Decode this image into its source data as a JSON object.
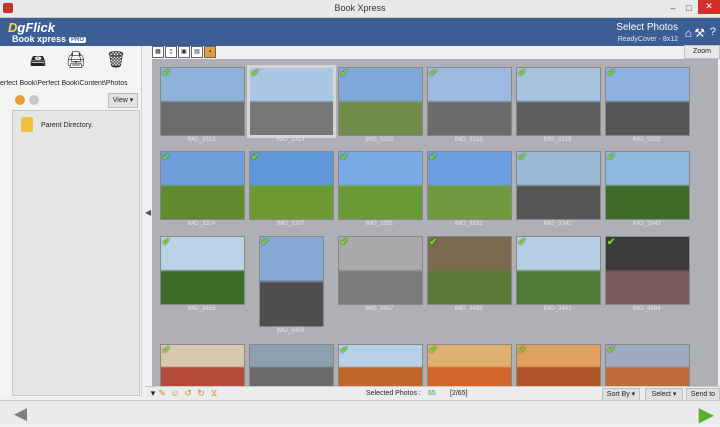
{
  "window": {
    "title": "Book Xpress",
    "min": "–",
    "max": "□",
    "close": "✕"
  },
  "header": {
    "logo_top_prefix": "D",
    "logo_top_rest": "gFlick",
    "logo_bottom": "Book xpress",
    "logo_badge": "PRO",
    "step_title": "Select Photos",
    "step_sub": "ReadyCover - 8x12",
    "icons": [
      "home-icon",
      "wrench-icon",
      "help-icon"
    ],
    "help_glyph": "?"
  },
  "sidebar": {
    "path": "erfect Book\\Perfect Book\\Content\\Photos",
    "view_label": "View ▾",
    "parent_dir_label": "Parent Directory."
  },
  "toolbar": {
    "zoom_label": "Zoom"
  },
  "thumbnails": [
    {
      "label": "IMG_3312",
      "checked": true
    },
    {
      "label": "IMG_3314",
      "checked": true,
      "selected": true
    },
    {
      "label": "IMG_3315",
      "checked": true
    },
    {
      "label": "IMG_3316",
      "checked": true
    },
    {
      "label": "IMG_3319",
      "checked": true
    },
    {
      "label": "IMG_3322",
      "checked": true
    },
    {
      "label": "IMG_3324",
      "checked": true
    },
    {
      "label": "IMG_3327",
      "checked": true
    },
    {
      "label": "IMG_3331",
      "checked": true
    },
    {
      "label": "IMG_3332",
      "checked": true
    },
    {
      "label": "IMG_3341",
      "checked": true
    },
    {
      "label": "IMG_3343",
      "checked": true
    },
    {
      "label": "IMG_3455",
      "checked": true
    },
    {
      "label": "IMG_3456",
      "checked": true
    },
    {
      "label": "IMG_3457",
      "checked": true
    },
    {
      "label": "IMG_3459",
      "checked": true
    },
    {
      "label": "IMG_3462",
      "checked": true
    },
    {
      "label": "IMG_3464",
      "checked": true
    },
    {
      "label": "",
      "checked": true
    },
    {
      "label": "",
      "checked": false
    },
    {
      "label": "",
      "checked": true
    },
    {
      "label": "",
      "checked": true
    },
    {
      "label": "",
      "checked": true
    },
    {
      "label": "",
      "checked": true
    }
  ],
  "bottom": {
    "selected_label": "Selected Photos :",
    "selected_count": "65",
    "selected_ratio": "[2/65]",
    "sort_label": "Sort By ▾",
    "select_label": "Select ▾",
    "send_label": "Send to"
  },
  "colors": {
    "accent": "#3b5f94",
    "check": "#7bd12d",
    "next": "#5ab02e"
  }
}
